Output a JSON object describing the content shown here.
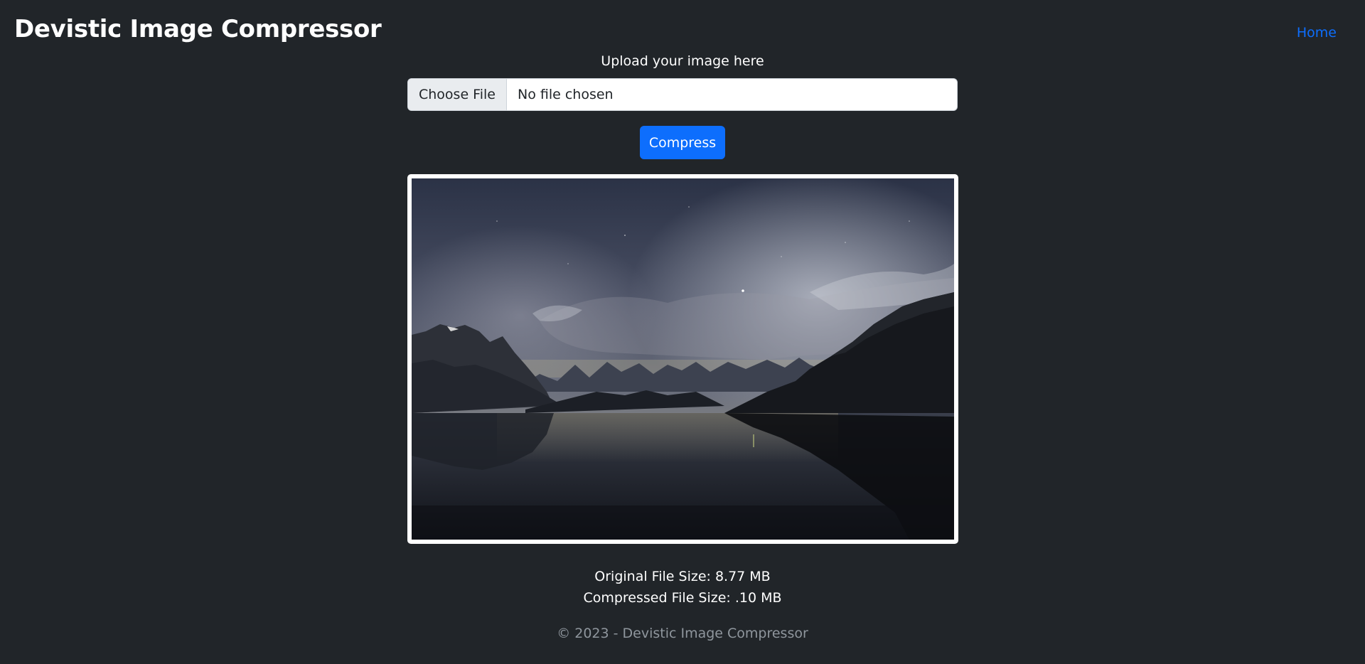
{
  "header": {
    "brand": "Devistic Image Compressor",
    "nav_home": "Home"
  },
  "upload": {
    "label": "Upload your image here",
    "choose_button": "Choose File",
    "file_status": "No file chosen"
  },
  "actions": {
    "compress_label": "Compress"
  },
  "preview": {
    "image_description_icon": "landscape-photo"
  },
  "stats": {
    "original_size": "Original File Size: 8.77 MB",
    "compressed_size": "Compressed File Size: .10 MB"
  },
  "footer": {
    "text": "© 2023 - Devistic Image Compressor"
  },
  "colors": {
    "background": "#212529",
    "accent": "#0d6efd",
    "muted": "#8f969d"
  }
}
